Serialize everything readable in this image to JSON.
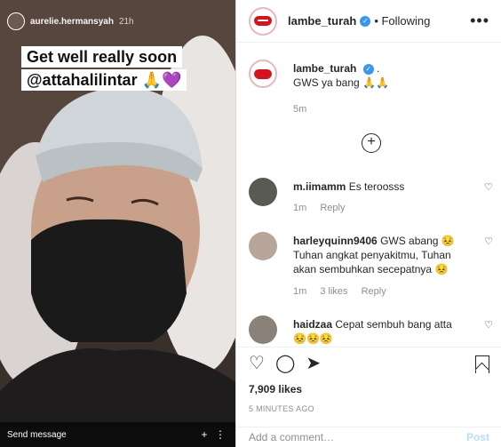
{
  "story": {
    "username": "aurelie.hermansyah",
    "time": "21h",
    "sticker_line1": "Get well really soon",
    "sticker_line2": "@attahalilintar 🙏💜",
    "send_placeholder": "Send message"
  },
  "post": {
    "author": "lambe_turah",
    "follow_label": "• Following",
    "caption_author": "lambe_turah",
    "caption_suffix": ".",
    "caption_text": "GWS ya bang 🙏🙏",
    "caption_time": "5m"
  },
  "comments": [
    {
      "user": "m.iimamm",
      "text": "Es teroosss",
      "time": "1m",
      "likes": "",
      "reply": "Reply"
    },
    {
      "user": "harleyquinn9406",
      "text": "GWS abang 😣 Tuhan angkat penyakitmu, Tuhan akan sembuhkan secepatnya 😣",
      "time": "1m",
      "likes": "3 likes",
      "reply": "Reply"
    },
    {
      "user": "haidzaa",
      "text": "Cepat sembuh bang atta 😣😣😣",
      "time": "",
      "likes": "",
      "reply": ""
    }
  ],
  "footer": {
    "likes": "7,909 likes",
    "posted": "5 MINUTES AGO",
    "add_comment_placeholder": "Add a comment…",
    "post_label": "Post"
  },
  "colors": {
    "verified": "#3897f0",
    "brand_lips": "#d8121d",
    "post_disabled": "#b2dffc"
  }
}
